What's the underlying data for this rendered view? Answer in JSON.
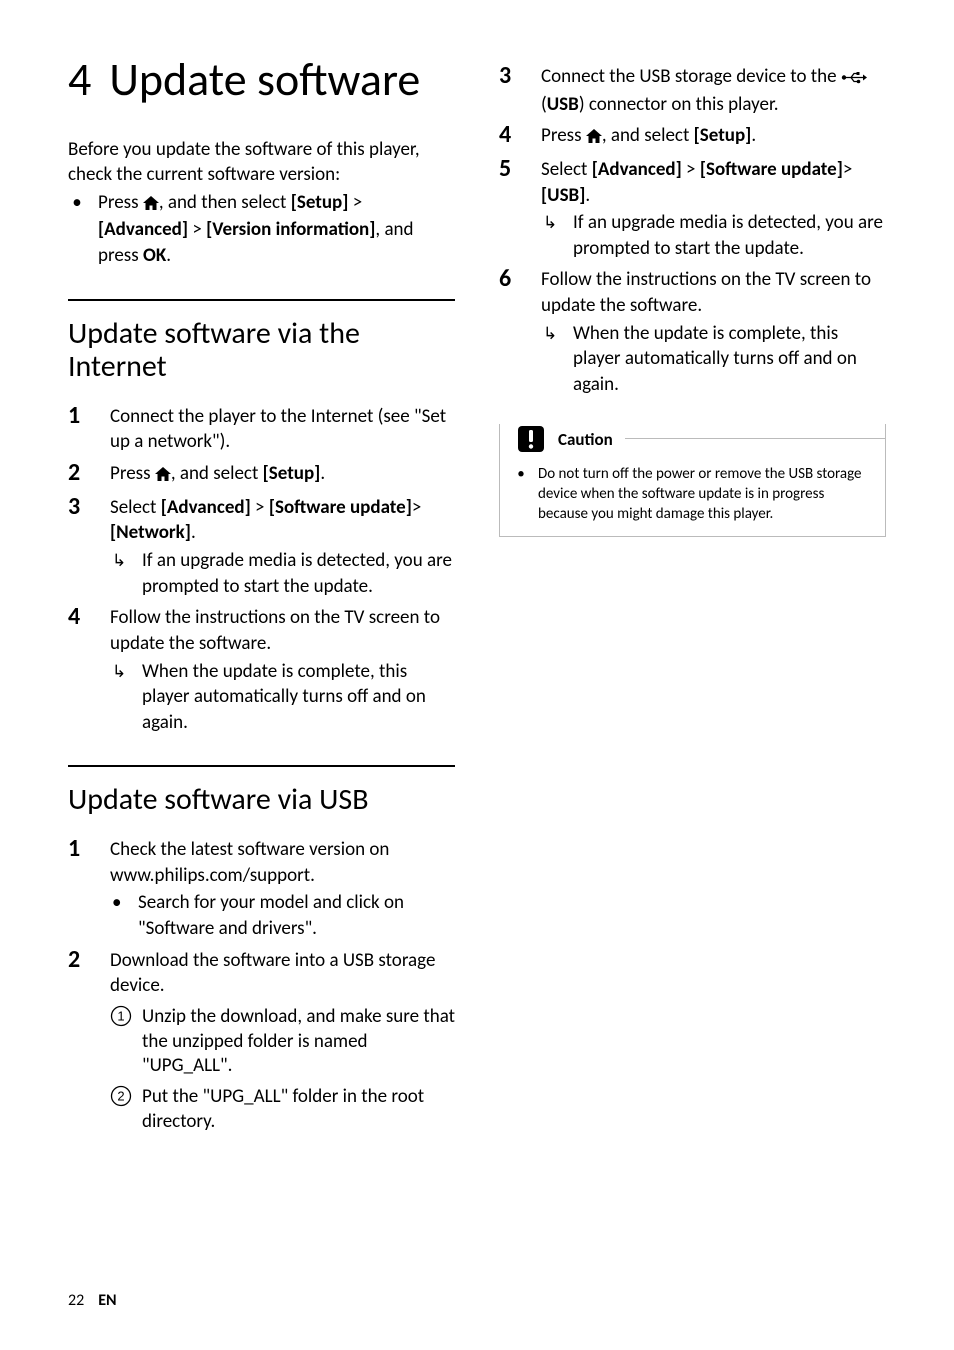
{
  "chapter": {
    "number": "4",
    "title": "Update software"
  },
  "intro": {
    "lead": "Before you update the software of this player, check the current software version:",
    "bullet_pre": "Press ",
    "bullet_mid1": ", and then select ",
    "setup": "[Setup]",
    "gt": " > ",
    "advanced": "[Advanced]",
    "version_info": "[Version information]",
    "bullet_mid2": ", and press ",
    "ok": "OK",
    "dot": "."
  },
  "section_internet": {
    "title": "Update software via the Internet"
  },
  "internet_steps": {
    "s1": "Connect the player to the Internet (see \"Set up a network\").",
    "s2_pre": "Press ",
    "s2_mid": ", and select ",
    "s2_setup": "[Setup]",
    "s3_pre": "Select ",
    "s3_advanced": "[Advanced]",
    "s3_swu": "[Software update]",
    "s3_net": "[Network]",
    "s3_result": "If an upgrade media is detected, you are prompted to start the update.",
    "s4": "Follow the instructions on the TV screen to update the software.",
    "s4_result": "When the update is complete, this player automatically turns off and on again."
  },
  "section_usb": {
    "title": "Update software via USB"
  },
  "usb_steps": {
    "s1": "Check the latest software version on www.philips.com/support.",
    "s1_sub": "Search for your model and click on \"Software and drivers\".",
    "s2": "Download the software into a USB storage device.",
    "s2_a": "Unzip the download, and make sure that the unzipped folder is named \"UPG_ALL\".",
    "s2_b": "Put the \"UPG_ALL\" folder in the root directory.",
    "s3_pre": "Connect the USB storage device to the ",
    "s3_usb_label": "USB",
    "s3_post": ") connector on this player.",
    "s4_pre": "Press ",
    "s4_mid": ", and select ",
    "s4_setup": "[Setup]",
    "s5_pre": "Select ",
    "s5_advanced": "[Advanced]",
    "s5_swu": "[Software update]",
    "s5_usb": "[USB]",
    "s5_result": "If an upgrade media is detected, you are prompted to start the update.",
    "s6": "Follow the instructions on the TV screen to update the software.",
    "s6_result": "When the update is complete, this player automatically turns off and on again."
  },
  "caution": {
    "label": "Caution",
    "text": "Do not turn off the power or remove the USB storage device when the software update is in progress because you might damage this player."
  },
  "footer": {
    "page": "22",
    "lang": "EN"
  }
}
